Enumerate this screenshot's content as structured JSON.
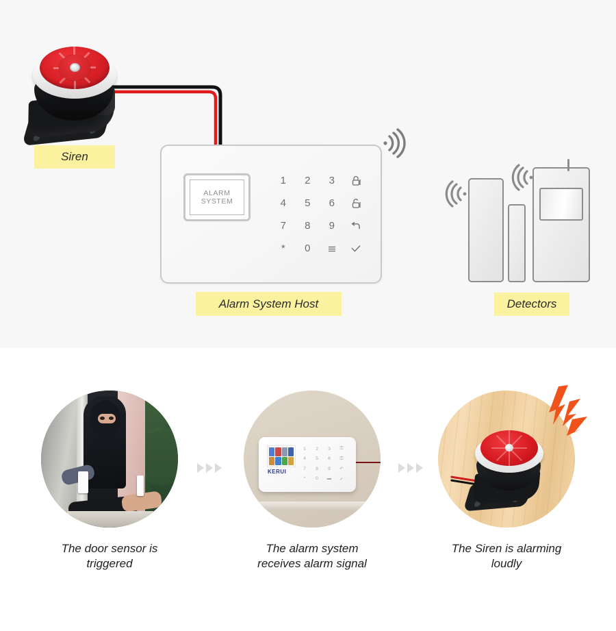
{
  "diagram": {
    "labels": {
      "siren": "Siren",
      "host": "Alarm System Host",
      "detectors": "Detectors"
    },
    "host_display": {
      "line1": "ALARM",
      "line2": "SYSTEM"
    },
    "keypad": [
      "1",
      "2",
      "3",
      "lock-closed-icon",
      "4",
      "5",
      "6",
      "lock-open-icon",
      "7",
      "8",
      "9",
      "back-arrow-icon",
      "*",
      "0",
      "menu-icon",
      "check-icon"
    ],
    "signal_icons": [
      "wifi-signal-icon-host",
      "wifi-signal-icon-door-sensor",
      "wifi-signal-icon-pir-detector"
    ],
    "background_color": "#f7f7f7",
    "label_color": "#fbf2a0"
  },
  "flow": {
    "steps": [
      {
        "caption": "The door sensor is\ntriggered",
        "caption_line1": "The door sensor is",
        "caption_line2": "triggered",
        "photo": "burglar-entering-door-with-sensor"
      },
      {
        "caption": "The alarm system\nreceives alarm signal",
        "caption_line1": "The alarm system",
        "caption_line2": "receives alarm signal",
        "photo": "kerui-alarm-panel-on-wall"
      },
      {
        "caption": "The Siren is alarming\nloudly",
        "caption_line1": "The Siren is alarming",
        "caption_line2": "loudly",
        "photo": "siren-sounding-on-wood"
      }
    ],
    "separator_icon": "triple-chevron-right-icon",
    "panel_brand": "KERUI"
  },
  "colors": {
    "siren_red": "#d81f26",
    "wire_red": "#e01b1b",
    "wire_black": "#111111",
    "alert_orange": "#f0521c",
    "brand_blue": "#2b3a97",
    "outline_grey": "#8d8d8d"
  }
}
